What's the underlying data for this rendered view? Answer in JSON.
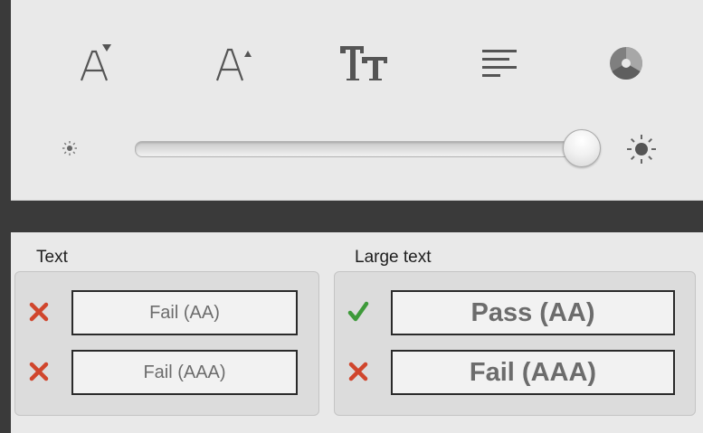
{
  "toolbar": {
    "buttons": [
      {
        "name": "decrease-font-size",
        "icon": "font-decrease-icon"
      },
      {
        "name": "increase-font-size",
        "icon": "font-increase-icon"
      },
      {
        "name": "text-style",
        "icon": "text-style-icon"
      },
      {
        "name": "align-left",
        "icon": "align-left-icon"
      },
      {
        "name": "color-wheel",
        "icon": "color-wheel-icon"
      }
    ]
  },
  "brightness": {
    "min_icon": "sun-small-icon",
    "max_icon": "sun-large-icon",
    "value": 0.97
  },
  "results": {
    "text": {
      "label": "Text",
      "aa": {
        "status": "fail",
        "label": "Fail (AA)"
      },
      "aaa": {
        "status": "fail",
        "label": "Fail (AAA)"
      }
    },
    "large_text": {
      "label": "Large text",
      "aa": {
        "status": "pass",
        "label": "Pass (AA)"
      },
      "aaa": {
        "status": "fail",
        "label": "Fail (AAA)"
      }
    }
  },
  "colors": {
    "fail": "#d0462d",
    "pass": "#3e9a3a"
  }
}
